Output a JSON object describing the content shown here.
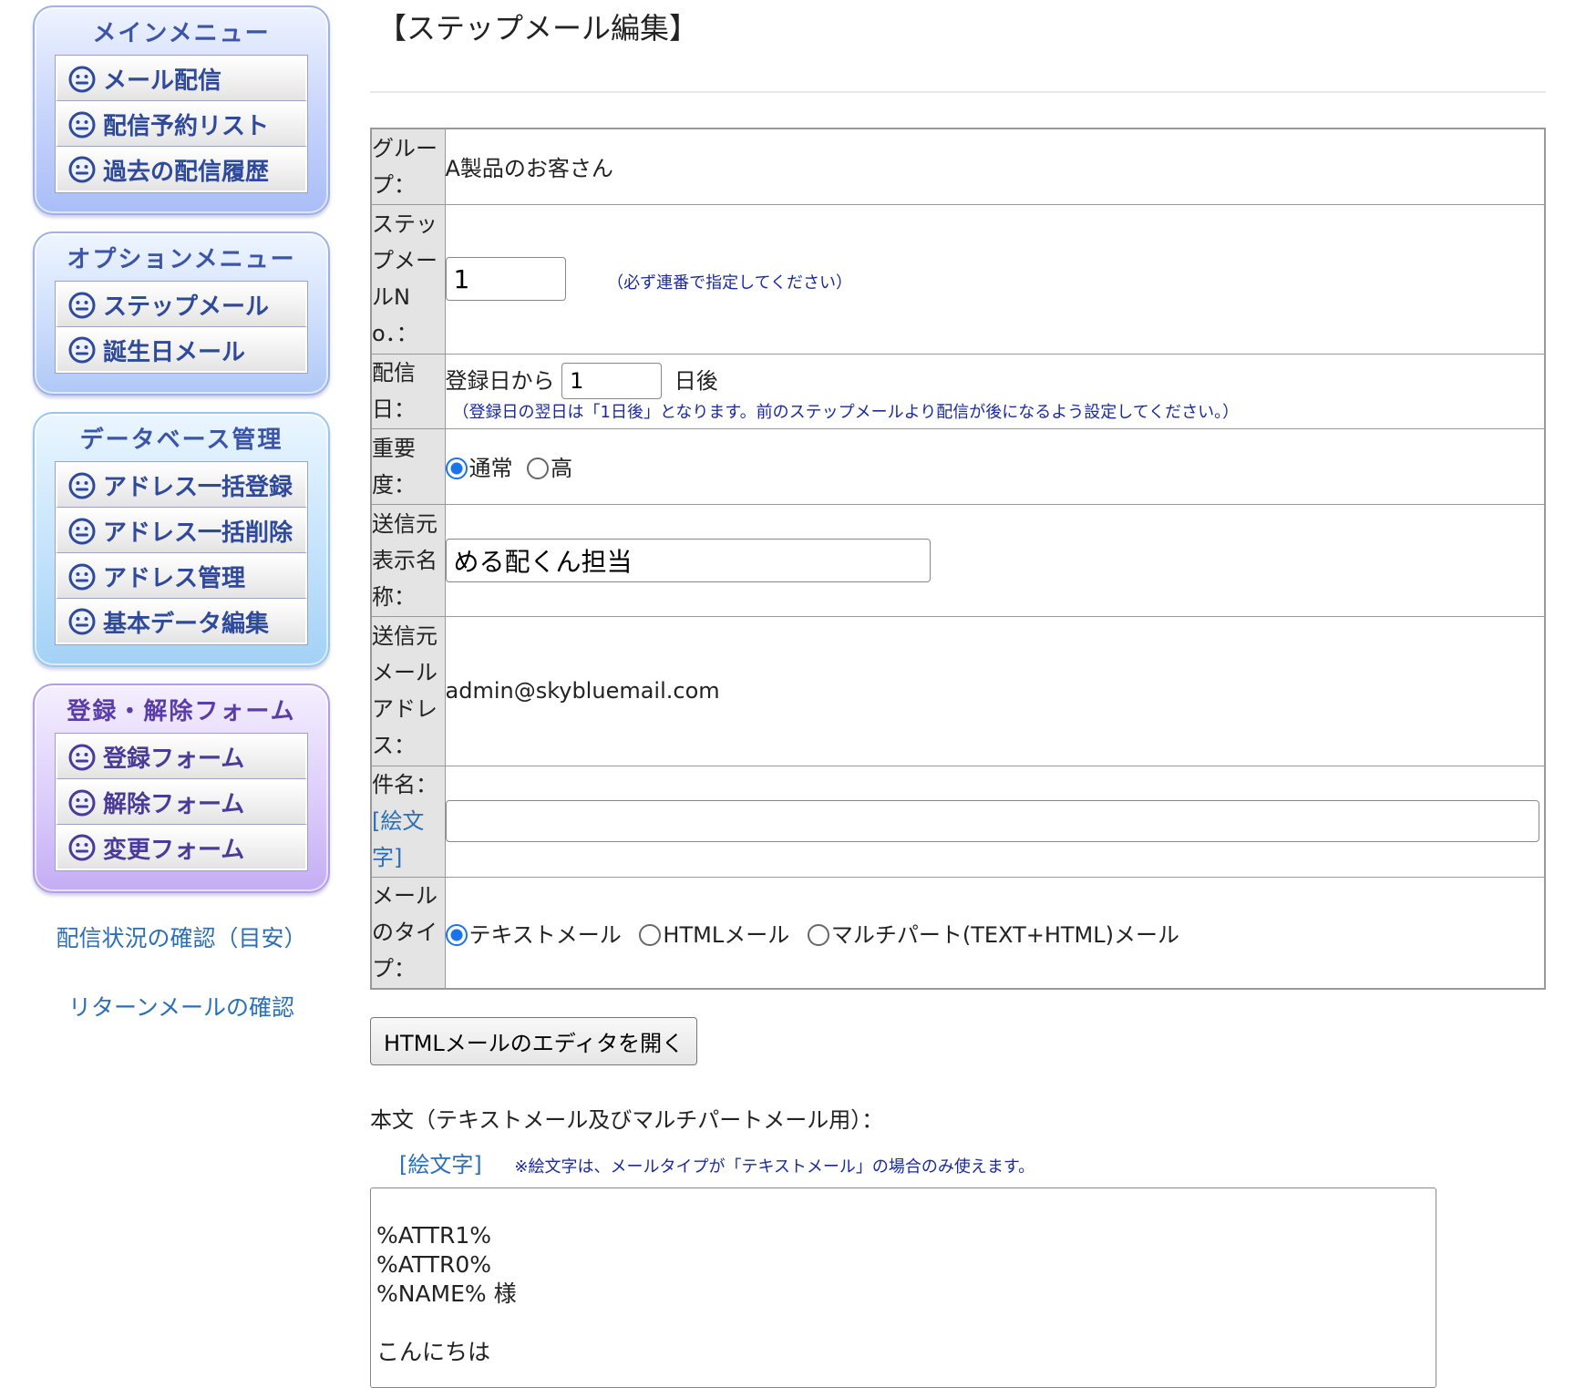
{
  "sidebar": {
    "main_menu": {
      "title": "メインメニュー",
      "items": [
        "メール配信",
        "配信予約リスト",
        "過去の配信履歴"
      ]
    },
    "option_menu": {
      "title": "オプションメニュー",
      "items": [
        "ステップメール",
        "誕生日メール"
      ]
    },
    "db_menu": {
      "title": "データベース管理",
      "items": [
        "アドレス一括登録",
        "アドレス一括削除",
        "アドレス管理",
        "基本データ編集"
      ]
    },
    "form_menu": {
      "title": "登録・解除フォーム",
      "items": [
        "登録フォーム",
        "解除フォーム",
        "変更フォーム"
      ]
    },
    "links": [
      "配信状況の確認（目安）",
      "リターンメールの確認"
    ]
  },
  "page_title": "【ステップメール編集】",
  "form": {
    "group": {
      "label": "グループ：",
      "value": "A製品のお客さん"
    },
    "step_no": {
      "label": "ステップメールNo．：",
      "value": "1",
      "note": "（必ず連番で指定してください）"
    },
    "send_day": {
      "label": "配信日：",
      "prefix": "登録日から",
      "value": "1",
      "suffix": "日後",
      "note": "（登録日の翌日は「1日後」となります。前のステップメールより配信が後になるよう設定してください。）"
    },
    "priority": {
      "label": "重要度：",
      "options": [
        "通常",
        "高"
      ],
      "selected": "通常"
    },
    "sender_name": {
      "label": "送信元表示名称：",
      "value": "める配くん担当"
    },
    "sender_address": {
      "label": "送信元メールアドレス：",
      "value": "admin@skybluemail.com"
    },
    "subject": {
      "label": "件名：",
      "emoji_link": "[絵文字]",
      "value": ""
    },
    "mail_type": {
      "label": "メールのタイプ：",
      "options": [
        "テキストメール",
        "HTMLメール",
        "マルチパート(TEXT+HTML)メール"
      ],
      "selected": "テキストメール"
    }
  },
  "html_editor_button": "HTMLメールのエディタを開く",
  "body": {
    "label": "本文（テキストメール及びマルチパートメール用）：",
    "emoji_link": "[絵文字]",
    "note": "※絵文字は、メールタイプが「テキストメール」の場合のみ使えます。",
    "text": "%ATTR1%\n%ATTR0%\n%NAME% 様\n\nこんにちは"
  }
}
